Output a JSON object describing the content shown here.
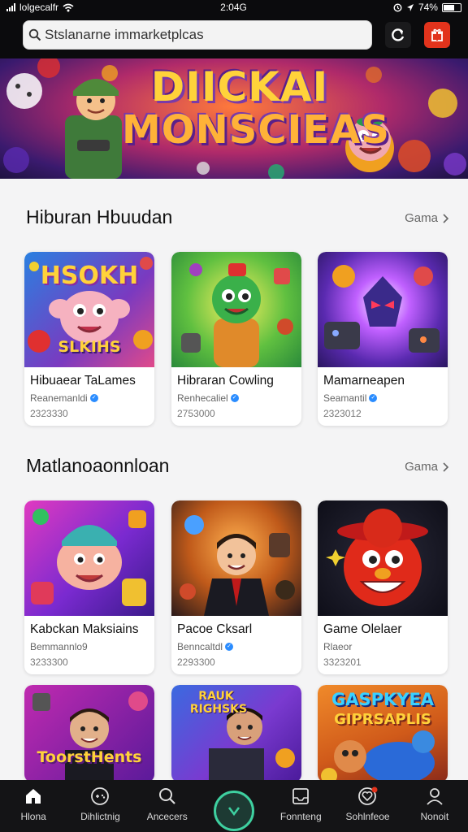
{
  "status": {
    "carrier": "lolgecalfr",
    "time": "2:04G",
    "battery": "74%"
  },
  "search": {
    "value": "Stslanarne immarketplcas"
  },
  "hero": {
    "line1": "DIICKAI",
    "line2": "MONSCIEAS"
  },
  "sections": [
    {
      "title": "Hiburan Hbuudan",
      "see_more": "Gama",
      "cards": [
        {
          "name": "Hibuaear TaLames",
          "developer": "Reanemanldi",
          "count": "2323330",
          "art_text_1": "HSOKH",
          "art_text_2": "SLKIHS"
        },
        {
          "name": "Hibraran Cowling",
          "developer": "Renhecaliel",
          "count": "2753000"
        },
        {
          "name": "Mamarneapen",
          "developer": "Seamantil",
          "count": "2323012"
        }
      ]
    },
    {
      "title": "Matlanoaonnloan",
      "see_more": "Gama",
      "cards": [
        {
          "name": "Kabckan Maksiains",
          "developer": "Bemmannlo9",
          "count": "3233300"
        },
        {
          "name": "Pacoe Cksarl",
          "developer": "Benncaltdl",
          "count": "2293300"
        },
        {
          "name": "Game Olelaer",
          "developer": "Rlaeor",
          "count": "3323201"
        }
      ]
    },
    {
      "cards": [
        {
          "art_text_1": "ToorstHents"
        },
        {
          "art_text_1": "RAUK",
          "art_text_2": "RIGHSKS"
        },
        {
          "art_text_1": "GASPKYEA",
          "art_text_2": "GIPRSAPLIS"
        }
      ]
    }
  ],
  "nav": [
    {
      "label": "Hlona",
      "icon": "home-icon"
    },
    {
      "label": "Dihlictnig",
      "icon": "controller-icon"
    },
    {
      "label": "Ancecers",
      "icon": "search-icon"
    },
    {
      "label": "",
      "icon": "check-icon"
    },
    {
      "label": "Fonnteng",
      "icon": "inbox-icon"
    },
    {
      "label": "Sohlnfeoe",
      "icon": "heart-icon"
    },
    {
      "label": "Nonoit",
      "icon": "profile-icon"
    }
  ],
  "colors": {
    "accent": "#3ed0a0",
    "gift": "#e2331c",
    "verified": "#2a8cff"
  }
}
